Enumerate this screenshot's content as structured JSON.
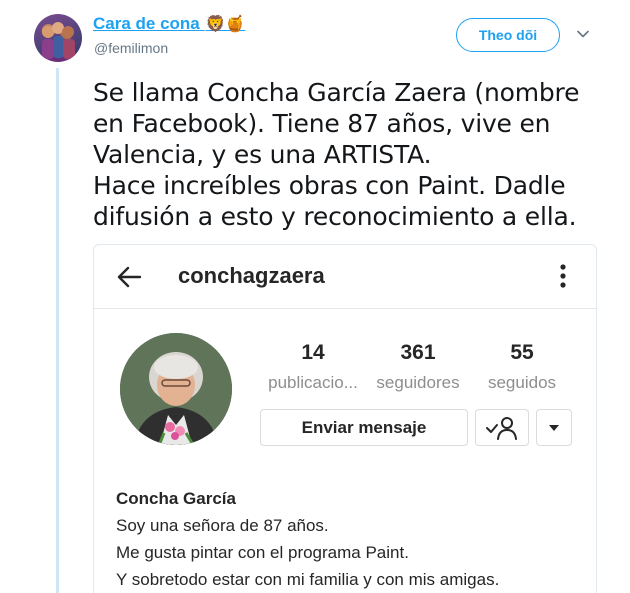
{
  "tweet": {
    "user_name": "Cara de cona",
    "user_emoji": "🦁🍯",
    "user_handle": "@femilimon",
    "follow_label": "Theo dõi",
    "text_lines": [
      "Se llama Concha García Zaera (nombre",
      "en Facebook). Tiene 87 años, vive en",
      "Valencia, y es una ARTISTA.",
      "Hace increíbles obras con Paint. Dadle",
      "difusión a esto y reconocimiento a ella."
    ]
  },
  "instagram": {
    "username": "conchagzaera",
    "stats": {
      "posts_count": "14",
      "posts_label": "publicacio...",
      "followers_count": "361",
      "followers_label": "seguidores",
      "following_count": "55",
      "following_label": "seguidos"
    },
    "message_button": "Enviar mensaje",
    "bio": {
      "name": "Concha García",
      "lines": [
        "Soy una señora de 87 años.",
        "Me gusta pintar con el programa Paint.",
        "Y sobretodo estar con mi familia y con mis amigas."
      ]
    }
  },
  "colors": {
    "twitter_blue": "#1da1f2",
    "thread_line": "#cfe6f7",
    "ig_text": "#262626",
    "ig_muted": "#8e8e8e"
  },
  "icons": [
    "back-arrow-icon",
    "more-vertical-icon",
    "following-check-icon",
    "dropdown-triangle-icon",
    "chevron-down-icon"
  ]
}
